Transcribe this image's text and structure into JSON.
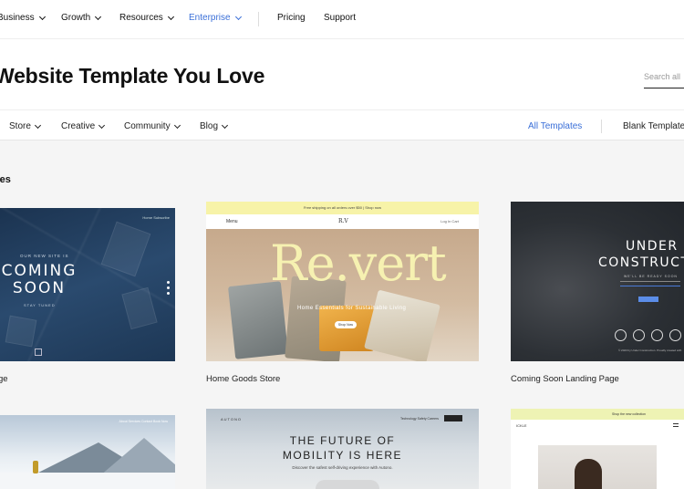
{
  "topnav": {
    "items": [
      {
        "label": "Business"
      },
      {
        "label": "Growth"
      },
      {
        "label": "Resources"
      },
      {
        "label": "Enterprise"
      },
      {
        "label": "Pricing"
      },
      {
        "label": "Support"
      }
    ]
  },
  "hero": {
    "title": "Website Template You Love",
    "search_placeholder": "Search all"
  },
  "categories": {
    "items": [
      {
        "label": "Store"
      },
      {
        "label": "Creative"
      },
      {
        "label": "Community"
      },
      {
        "label": "Blog"
      }
    ],
    "all_templates": "All Templates",
    "blank_templates": "Blank Templates"
  },
  "section": {
    "title": "tes"
  },
  "cards": [
    {
      "label": "ge",
      "preview": {
        "nav": "Home  Subscribe",
        "small": "OUR NEW SITE IS",
        "big_line1": "COMING",
        "big_line2": "SOON",
        "sub": "STAY TUNED"
      }
    },
    {
      "label": "Home Goods Store",
      "preview": {
        "strip": "Free shipping on all orders over $50 | Shop now",
        "menu": "Menu",
        "logo": "R.V",
        "right": "Log In  Cart",
        "word": "Re.vert",
        "tagline": "Home Essentials for Sustainable Living",
        "button": "Shop Now"
      }
    },
    {
      "label": "Coming Soon Landing Page",
      "preview": {
        "title_line1": "UNDER",
        "title_line2": "CONSTRUCTION",
        "tiny": "WE'LL BE READY SOON",
        "footer": "© 2023 by Under Construction. Proudly created with"
      }
    },
    {
      "label": "",
      "preview": {
        "nav": "About  Services  Contact  Book Now"
      }
    },
    {
      "label": "",
      "preview": {
        "logo": "AUTONO",
        "nav": "Technology  Safety  Careers",
        "headline_line1": "THE FUTURE OF",
        "headline_line2": "MOBILITY IS HERE",
        "sub": "Discover the safest self-driving experience with Autono."
      }
    },
    {
      "label": "",
      "preview": {
        "strip": "Shop the new collection",
        "logo": "ICKLE"
      }
    }
  ],
  "colors": {
    "accent": "#3a6fd8"
  }
}
